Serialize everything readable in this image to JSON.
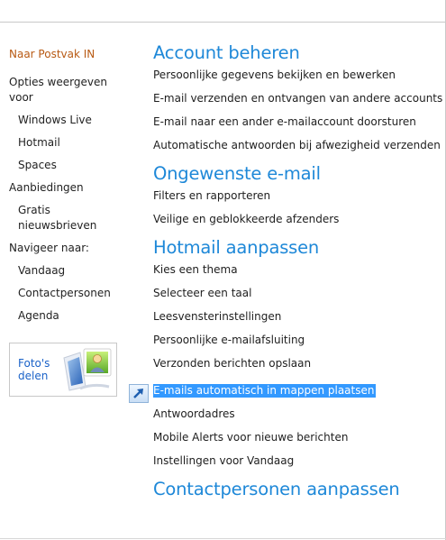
{
  "sidebar": {
    "inbox_link": "Naar Postvak IN",
    "options_heading": "Opties weergeven voor",
    "options_items": [
      "Windows Live",
      "Hotmail",
      "Spaces"
    ],
    "offers_heading": "Aanbiedingen",
    "offers_items": [
      "Gratis nieuwsbrieven"
    ],
    "navigate_heading": "Navigeer naar:",
    "navigate_items": [
      "Vandaag",
      "Contactpersonen",
      "Agenda"
    ],
    "photo_promo": "Foto's delen"
  },
  "sections": [
    {
      "title": "Account beheren",
      "links": [
        "Persoonlijke gegevens bekijken en bewerken",
        "E-mail verzenden en ontvangen van andere accounts",
        "E-mail naar een ander e-mailaccount doorsturen",
        "Automatische antwoorden bij afwezigheid verzenden"
      ]
    },
    {
      "title": "Ongewenste e-mail",
      "links": [
        "Filters en rapporteren",
        "Veilige en geblokkeerde afzenders"
      ]
    },
    {
      "title": "Hotmail aanpassen",
      "links": [
        "Kies een thema",
        "Selecteer een taal",
        "Leesvensterinstellingen",
        "Persoonlijke e-mailafsluiting",
        "Verzonden berichten opslaan",
        "E-mails automatisch in mappen plaatsen",
        "Antwoordadres",
        "Mobile Alerts voor nieuwe berichten",
        "Instellingen voor Vandaag"
      ],
      "highlighted_index": 5
    },
    {
      "title": "Contactpersonen aanpassen",
      "links": []
    }
  ],
  "colors": {
    "section_title": "#1e88d8",
    "inbox_link": "#b85a14",
    "promo_link": "#1a62c8",
    "selection": "#3399ff"
  },
  "icons": {
    "photo_promo": "photo-share-icon",
    "drag_cursor": "shortcut-arrow-icon"
  }
}
